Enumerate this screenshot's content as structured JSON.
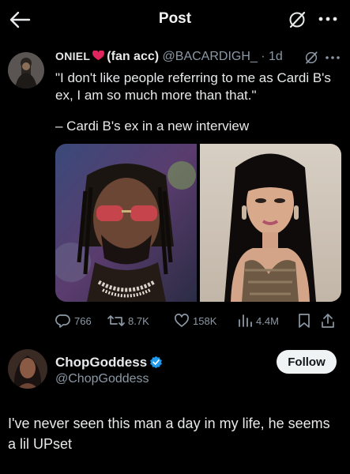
{
  "header": {
    "title": "Post"
  },
  "quoted": {
    "name": "ONIEL",
    "display_suffix": "(fan acc)",
    "handle": "@BACARDIGH_",
    "time": "1d",
    "text": "\"I don't like people referring to me as Cardi B's ex, I am so much more than that.\"",
    "attribution": "– Cardi B's ex in a new interview",
    "stats": {
      "replies": "766",
      "reposts": "8.7K",
      "likes": "158K",
      "views": "4.4M"
    }
  },
  "reply": {
    "name": "ChopGoddess",
    "handle": "@ChopGoddess",
    "follow_label": "Follow",
    "text": "I've never seen this man a day in my life, he seems a lil UPset"
  },
  "colors": {
    "background": "#000000",
    "text": "#e7e9ea",
    "muted": "#8b98a5",
    "verified": "#1d9bf0",
    "follow_bg": "#eff3f4"
  },
  "icons": [
    "back-arrow-icon",
    "grok-icon",
    "more-icon",
    "kiss-icon",
    "reply-icon",
    "repost-icon",
    "like-icon",
    "views-icon",
    "bookmark-icon",
    "share-icon",
    "verified-icon"
  ]
}
